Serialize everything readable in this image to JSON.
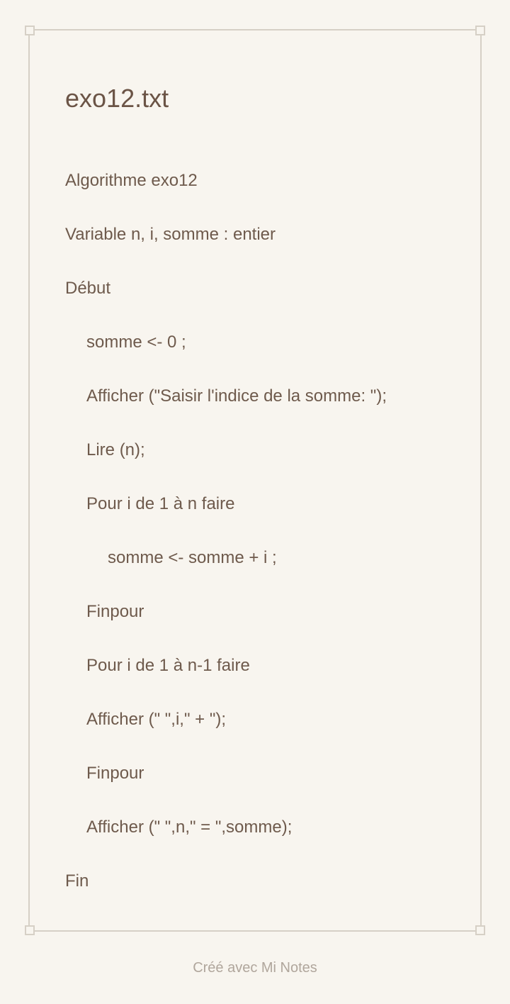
{
  "note": {
    "title": "exo12.txt",
    "lines": [
      "Algorithme exo12",
      "Variable n, i, somme : entier",
      "Début",
      "somme <- 0 ;",
      "Afficher (\"Saisir l'indice de la somme: \");",
      "Lire (n);",
      "Pour i de 1 à n faire",
      "somme <- somme + i ;",
      "Finpour",
      "Pour i de 1 à n-1 faire",
      "Afficher (\" \",i,\" + \");",
      "Finpour",
      "Afficher (\" \",n,\" = \",somme);",
      "Fin"
    ]
  },
  "footer": {
    "credit": "Créé avec Mi Notes"
  }
}
